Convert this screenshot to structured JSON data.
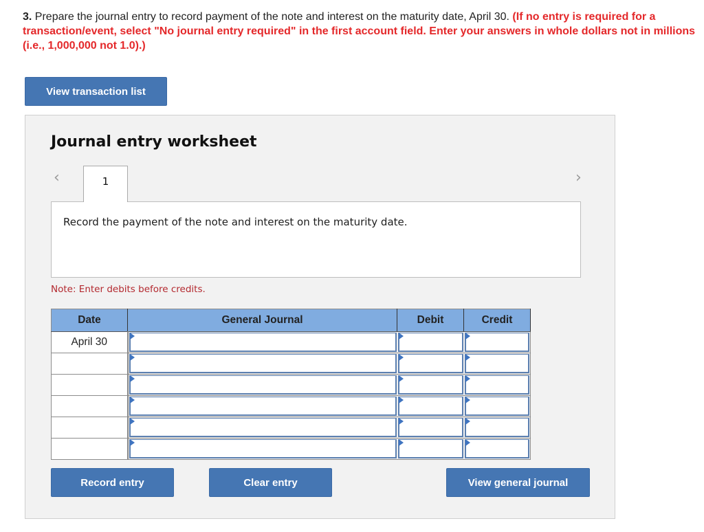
{
  "question": {
    "number": "3.",
    "text": " Prepare the journal entry to record payment of the note and interest on the maturity date, April 30. ",
    "instruction": "(If no entry is required for a transaction/event, select \"No journal entry required\" in the first account field. Enter your answers in whole dollars not in millions (i.e., 1,000,000 not 1.0).)"
  },
  "buttons": {
    "view_transaction_list": "View transaction list",
    "record_entry": "Record entry",
    "clear_entry": "Clear entry",
    "view_general_journal": "View general journal"
  },
  "worksheet": {
    "title": "Journal entry worksheet",
    "prev_icon": "‹",
    "next_icon": "›",
    "tabs": [
      {
        "label": "1"
      }
    ],
    "description": "Record the payment of the note and interest on the maturity date.",
    "note": "Note: Enter debits before credits."
  },
  "table": {
    "headers": {
      "date": "Date",
      "account": "General Journal",
      "debit": "Debit",
      "credit": "Credit"
    },
    "rows": [
      {
        "date": "April 30",
        "account": "",
        "debit": "",
        "credit": ""
      },
      {
        "date": "",
        "account": "",
        "debit": "",
        "credit": ""
      },
      {
        "date": "",
        "account": "",
        "debit": "",
        "credit": ""
      },
      {
        "date": "",
        "account": "",
        "debit": "",
        "credit": ""
      },
      {
        "date": "",
        "account": "",
        "debit": "",
        "credit": ""
      },
      {
        "date": "",
        "account": "",
        "debit": "",
        "credit": ""
      }
    ]
  },
  "colors": {
    "button_bg": "#4576b3",
    "header_bg": "#80ace0",
    "instruction_red": "#e4282a",
    "note_red": "#b3282e"
  }
}
